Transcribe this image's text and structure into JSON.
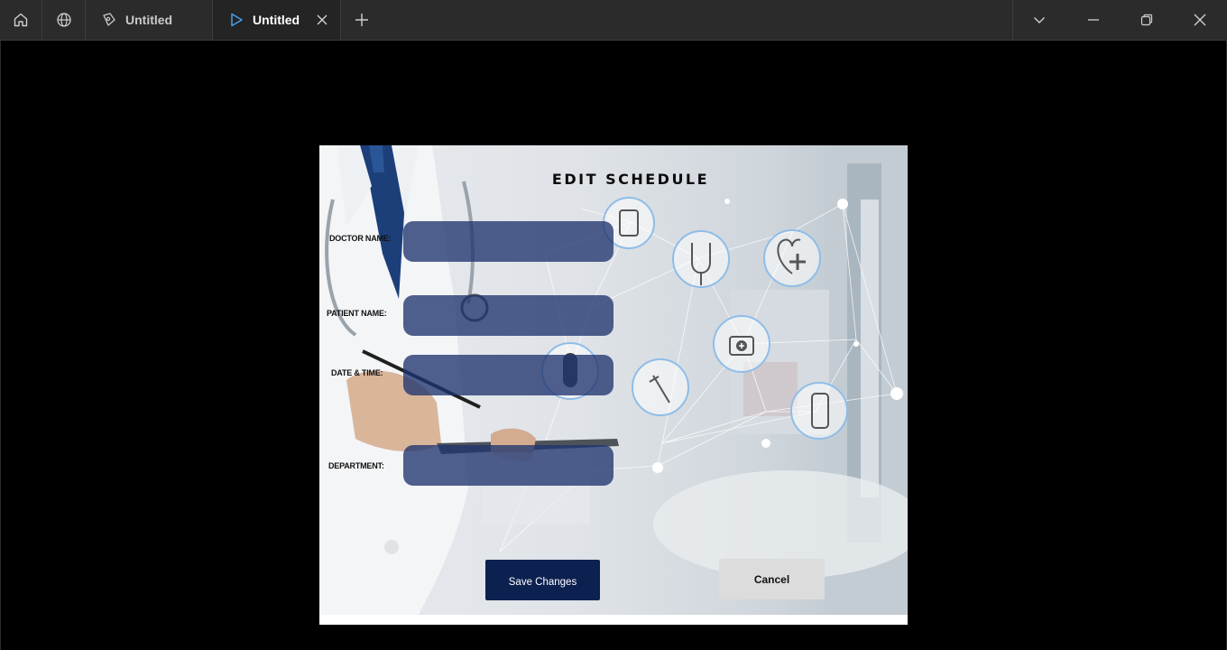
{
  "window": {
    "tabs": [
      {
        "label": "Untitled",
        "icon": "design-file-icon",
        "active": false
      },
      {
        "label": "Untitled",
        "icon": "play-icon",
        "active": true
      }
    ],
    "new_tab_icon": "plus-icon",
    "controls": [
      "chevron-down-icon",
      "minimize-icon",
      "restore-icon",
      "close-icon"
    ]
  },
  "form": {
    "title": "EDIT SCHEDULE",
    "fields": [
      {
        "label": "DOCTOR NAME:",
        "value": ""
      },
      {
        "label": "PATIENT NAME:",
        "value": ""
      },
      {
        "label": "DATE & TIME:",
        "value": ""
      },
      {
        "label": "DEPARTMENT:",
        "value": ""
      }
    ],
    "save_label": "Save Changes",
    "cancel_label": "Cancel"
  },
  "colors": {
    "titlebar": "#2b2b2b",
    "field_fill": "#203470",
    "save_button": "#0d2150",
    "cancel_button": "#dcdcdc",
    "active_tab_icon": "#4a9fe8"
  }
}
